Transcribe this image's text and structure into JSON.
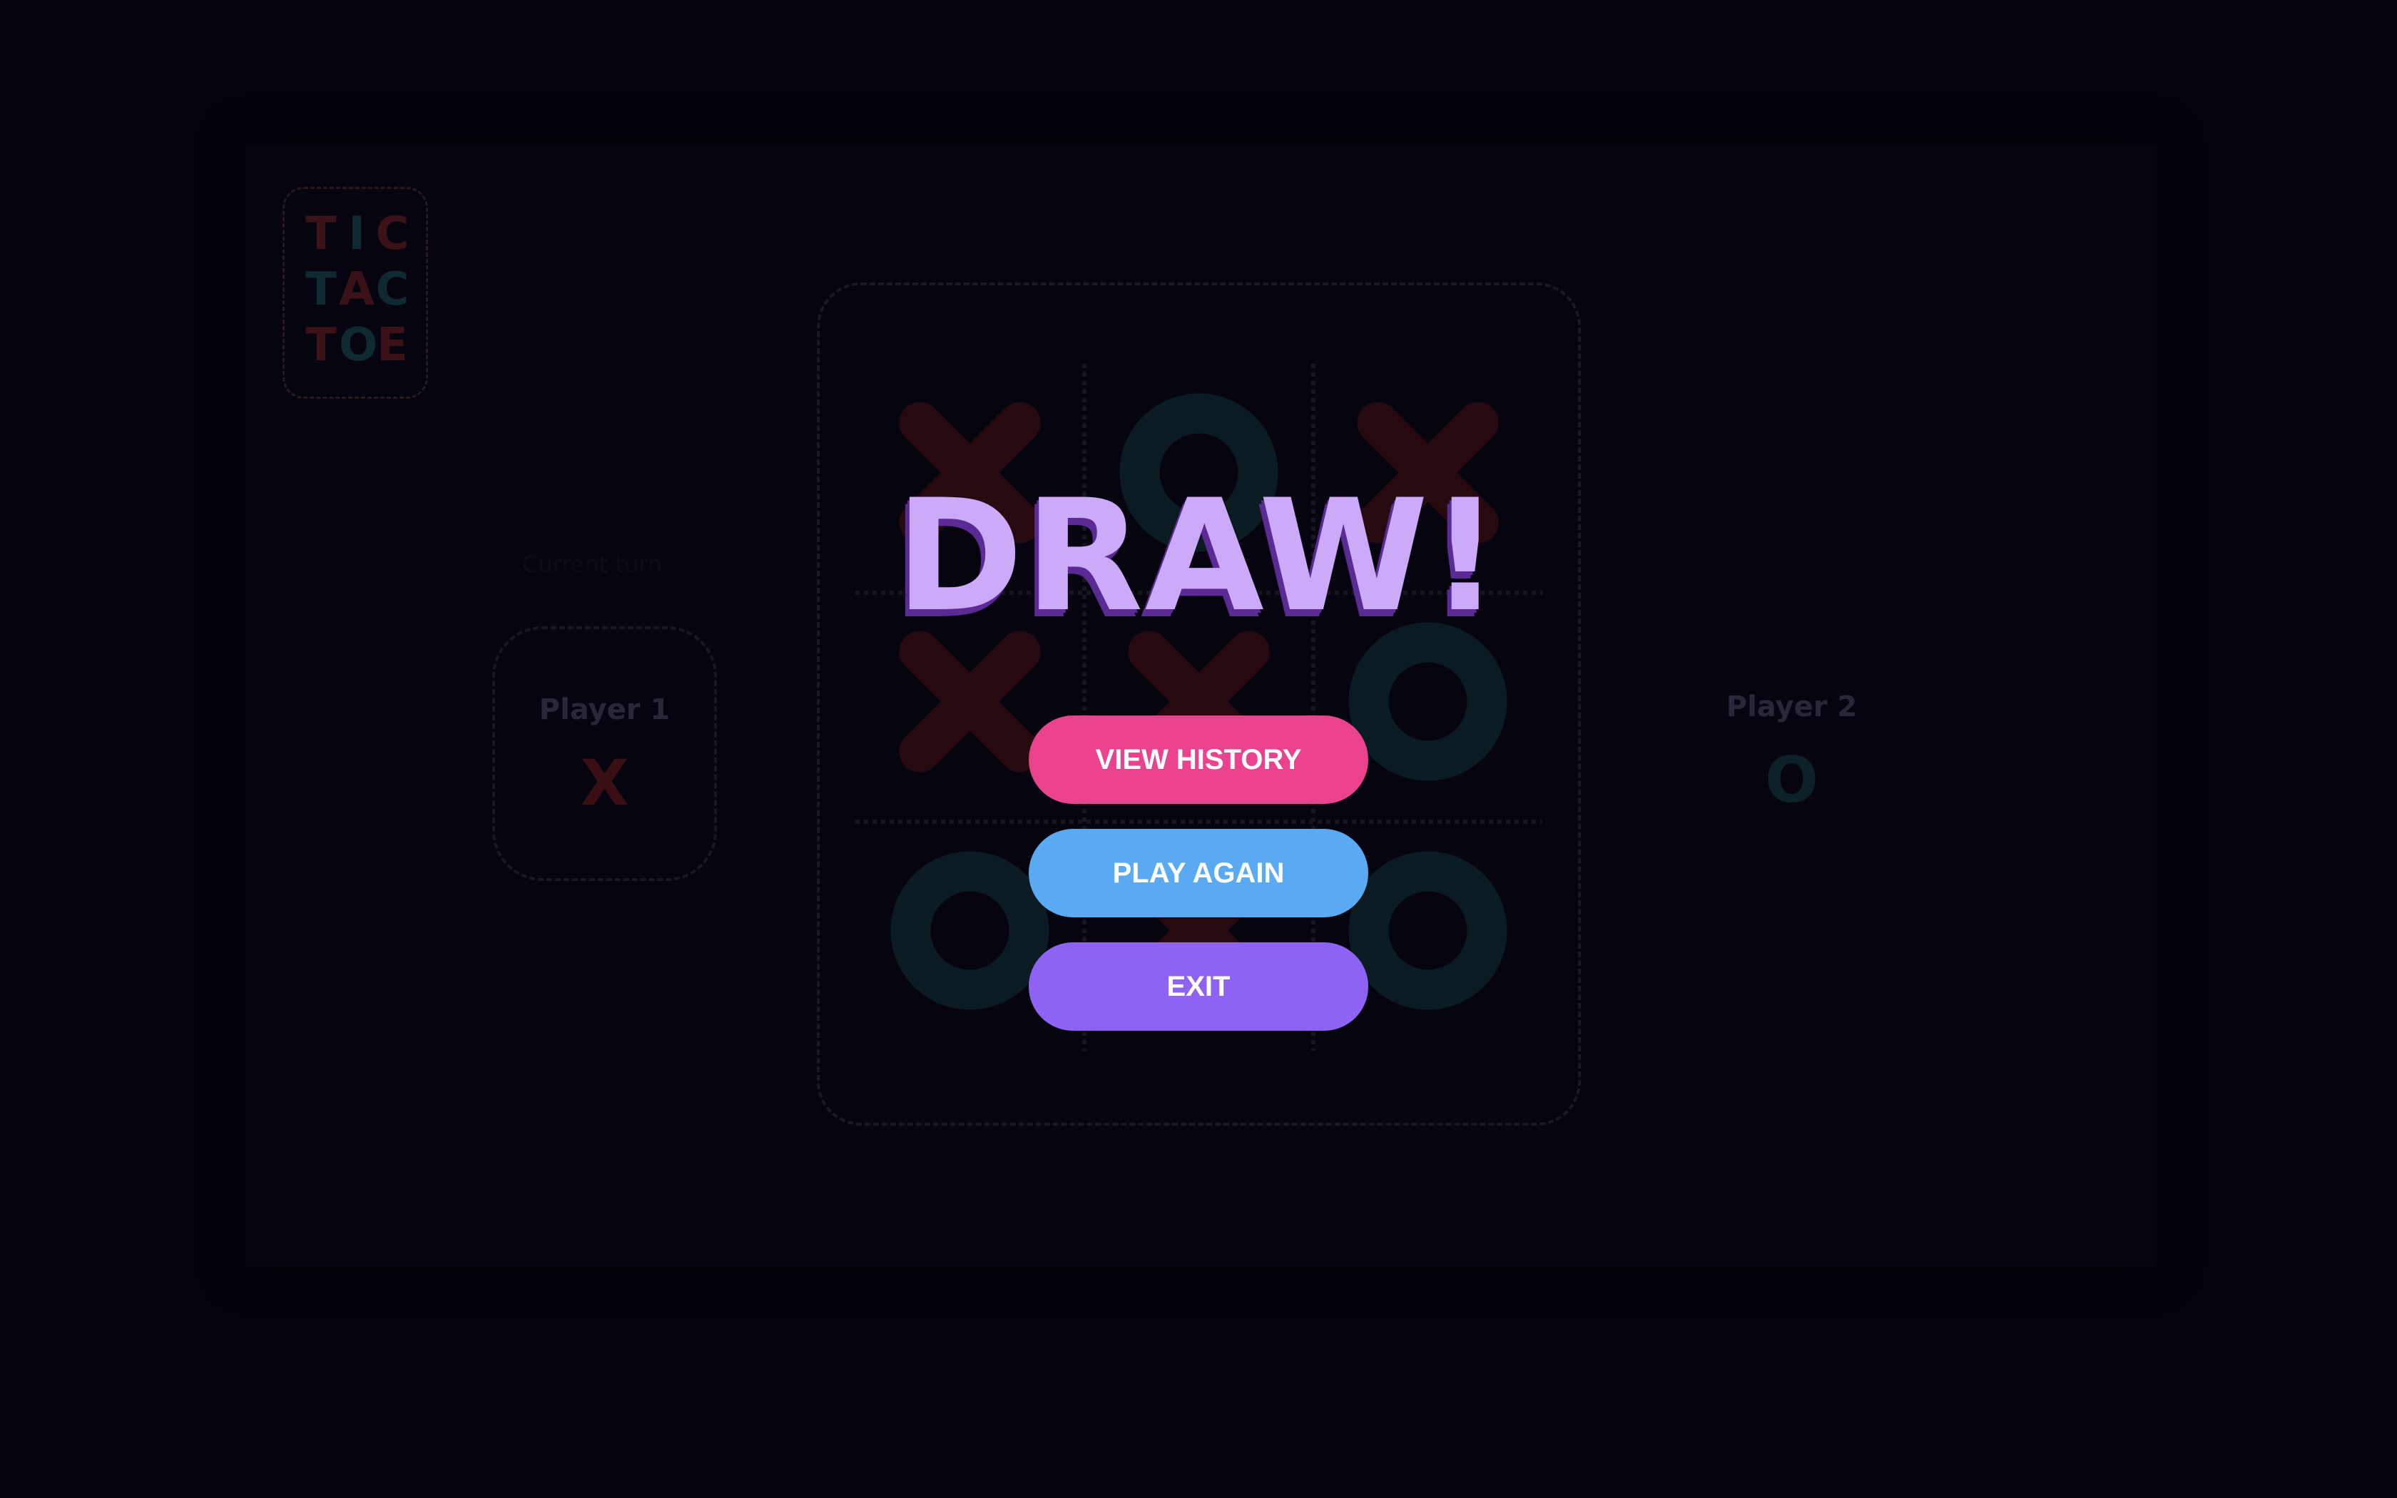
{
  "logo": {
    "rows": [
      [
        {
          "ch": "T",
          "color": "#3a1218"
        },
        {
          "ch": "I",
          "color": "#0f2a30"
        },
        {
          "ch": "C",
          "color": "#3a1218"
        }
      ],
      [
        {
          "ch": "T",
          "color": "#0f2a30"
        },
        {
          "ch": "A",
          "color": "#3a1218"
        },
        {
          "ch": "C",
          "color": "#0f2a30"
        }
      ],
      [
        {
          "ch": "T",
          "color": "#3a1218"
        },
        {
          "ch": "O",
          "color": "#0f2a30"
        },
        {
          "ch": "E",
          "color": "#3a1218"
        }
      ]
    ]
  },
  "turn_label": "Current turn",
  "players": [
    {
      "name": "Player 1",
      "mark": "X",
      "mark_color": "#3a0f14"
    },
    {
      "name": "Player 2",
      "mark": "O",
      "mark_color": "#0c2227"
    }
  ],
  "board": {
    "cells": [
      "X",
      "O",
      "X",
      "X",
      "X",
      "O",
      "O",
      "X",
      "O"
    ],
    "colors": {
      "X": "#260a10",
      "O": "#0a1c21",
      "grid": "#17161e"
    }
  },
  "result": {
    "title": "DRAW!",
    "buttons": [
      {
        "label": "VIEW HISTORY",
        "color": "#ea428c"
      },
      {
        "label": "PLAY AGAIN",
        "color": "#5aaaf3"
      },
      {
        "label": "EXIT",
        "color": "#8e63f3"
      }
    ]
  }
}
